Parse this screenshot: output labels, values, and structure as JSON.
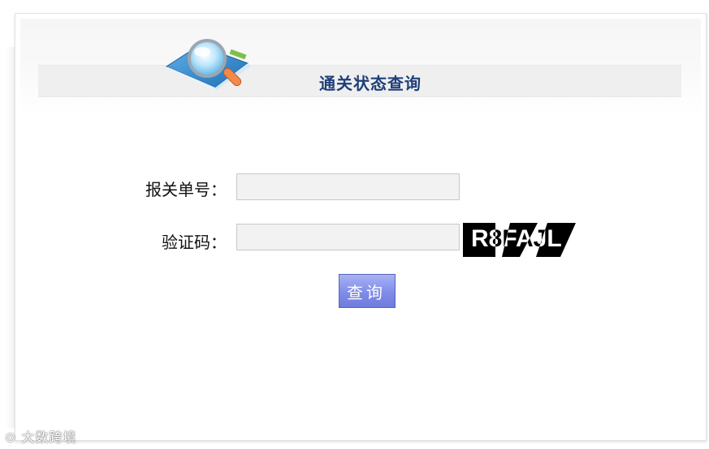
{
  "header": {
    "title": "通关状态查询",
    "logo_icon": "magnifier-over-book"
  },
  "form": {
    "declaration_label": "报关单号：",
    "declaration_value": "",
    "captcha_label": "验证码：",
    "captcha_value": "",
    "captcha_text": "R8FAJL",
    "submit_label": "查询"
  },
  "watermark": {
    "text": "大数跨境"
  },
  "colors": {
    "title": "#1e3f7a",
    "button": "#7f8ce8",
    "input_bg": "#f2f2f2"
  }
}
